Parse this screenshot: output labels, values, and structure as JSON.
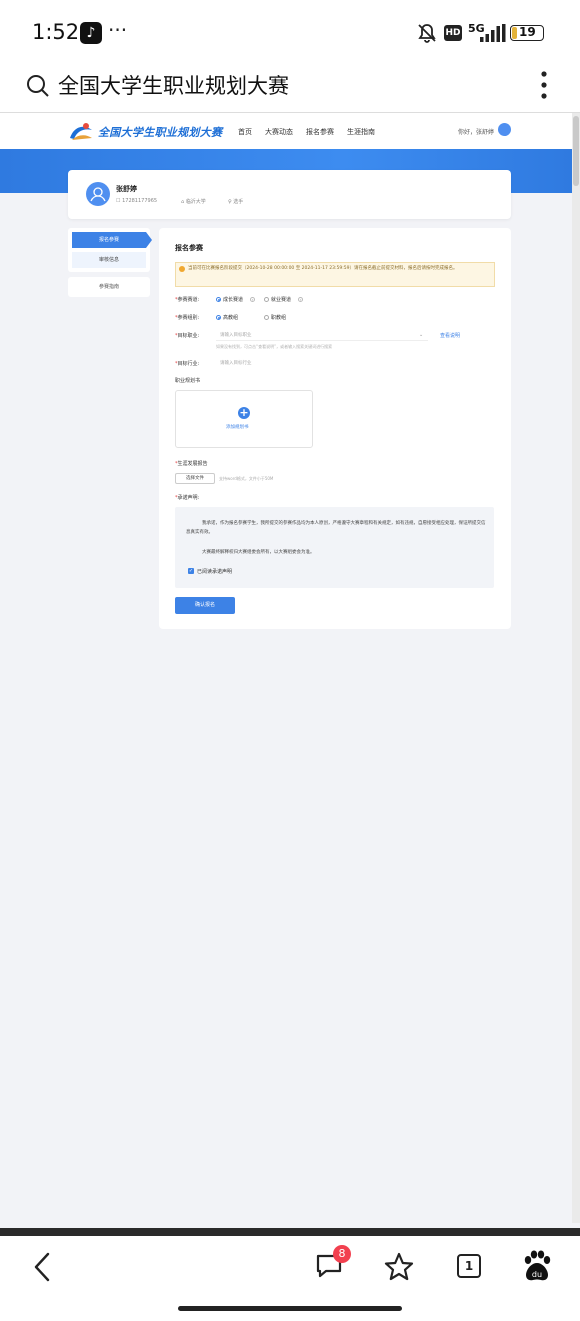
{
  "status_bar": {
    "time": "1:52",
    "tiktok_glyph": "♪",
    "more": "···",
    "hd": "HD",
    "network": "5G",
    "battery": "19"
  },
  "browser": {
    "address_text": "全国大学生职业规划大赛"
  },
  "site": {
    "title": "全国大学生职业规划大赛",
    "nav": [
      "首页",
      "大赛动态",
      "报名参赛",
      "生涯指南"
    ],
    "greeting": "你好，张舒婷"
  },
  "profile": {
    "name": "张舒婷",
    "phone": "17281177965",
    "school": "临沂大学",
    "role": "选手"
  },
  "sidebar": {
    "items": [
      "报名参赛",
      "审核信息",
      "参赛指南"
    ]
  },
  "form": {
    "title": "报名参赛",
    "notice": "当前可在比赛报名阶段提交（2024-10-28 00:00:00 至 2024-11-17 23:59:59）请在报名截止前提交材料，报名后请按时完成报名。",
    "track_label": "参赛赛道:",
    "track_options": [
      "成长赛道",
      "就业赛道"
    ],
    "group_label": "参赛组别:",
    "group_options": [
      "高教组",
      "职教组"
    ],
    "job_label": "目标职业:",
    "job_placeholder": "请输入目标职业",
    "job_caret": "⌄",
    "job_hint": "如果没有找到，可点击“查看说明”，或者输入搜索关键词进行搜索",
    "job_link": "查看说明",
    "industry_label": "目标行业:",
    "industry_placeholder": "请输入目标行业",
    "upload_title": "职业规划书",
    "upload_plus": "+",
    "upload_text": "添加规划书",
    "report_label": "生涯发展报告",
    "select_file": "选择文件",
    "file_hint": "支持word格式，文件小于50M",
    "statement_label": "承诺声明:",
    "statement_p1": "我承诺，作为报名参赛学生，我所提交的参赛作品均为本人原创，严格遵守大赛章程和有关规定，如有违规，自愿接受相应处理，保证所提交信息真实有效。",
    "statement_p2": "大赛最终解释权归大赛组委会所有，以大赛组委会为准。",
    "agree_text": "已阅读承诺声明",
    "agree_check": "✓",
    "submit": "确认报名"
  },
  "toolbar": {
    "chat_badge": "8",
    "tabs_count": "1"
  },
  "colors": {
    "accent": "#3d82e6",
    "banner": "#2f7ae0",
    "badge": "#f2404f"
  }
}
